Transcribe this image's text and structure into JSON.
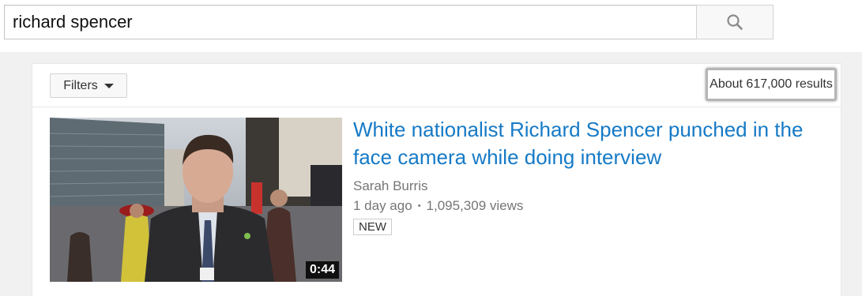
{
  "search": {
    "query": "richard spencer",
    "button_icon": "search-icon"
  },
  "toolbar": {
    "filters_label": "Filters",
    "results_count": "About 617,000 results"
  },
  "results": [
    {
      "title": "White nationalist Richard Spencer punched in the face camera while doing interview",
      "channel": "Sarah Burris",
      "age": "1 day ago",
      "separator": "•",
      "views": "1,095,309 views",
      "badge": "NEW",
      "duration": "0:44"
    }
  ],
  "colors": {
    "link": "#167ac6",
    "meta": "#767676",
    "page_bg": "#f1f1f1"
  }
}
